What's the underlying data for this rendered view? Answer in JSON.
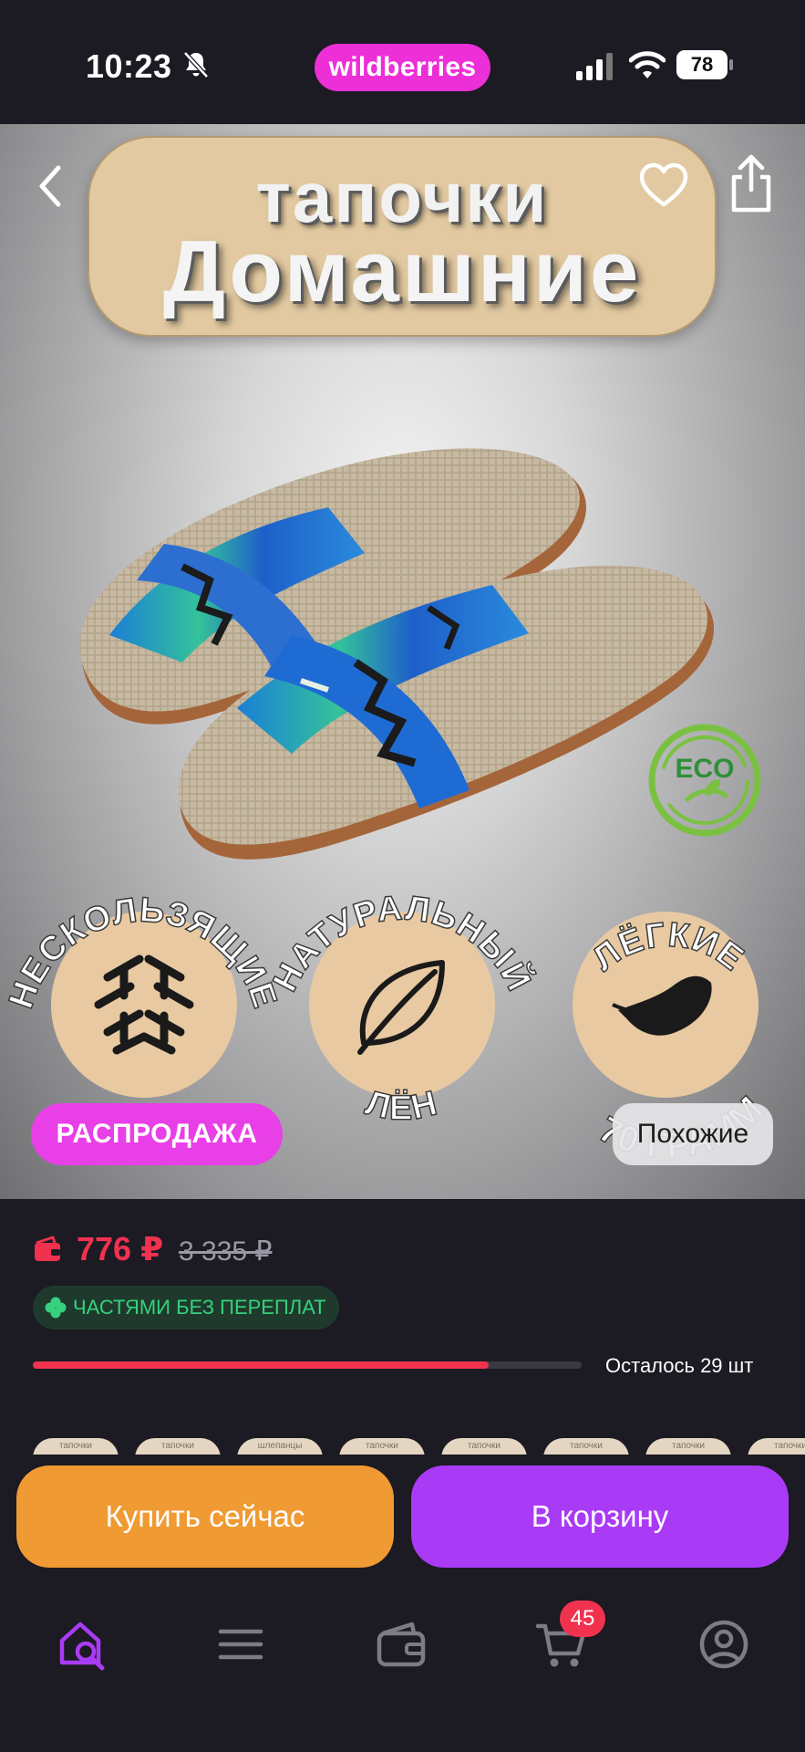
{
  "status_bar": {
    "time": "10:23",
    "brand": "wildberries",
    "battery": "78",
    "icons": [
      "bell-off-icon",
      "signal-icon",
      "wifi-icon",
      "battery-icon"
    ]
  },
  "product_nav": {
    "icons": [
      "back-chevron-icon",
      "heart-icon",
      "share-icon"
    ]
  },
  "product_image": {
    "title_line1": "тапочки",
    "title_line2": "Домашние",
    "eco_badge": "ECO",
    "features": [
      {
        "label": "НЕСКОЛЬЗЯЩИЕ",
        "icon": "weave-pattern-icon"
      },
      {
        "label_top": "НАТУРАЛЬНЫЙ",
        "label_bottom": "ЛЁН",
        "icon": "leaf-icon"
      },
      {
        "label_top": "ЛЁГКИЕ",
        "label_bottom": "70 ГРАММ",
        "icon": "feather-icon"
      }
    ],
    "sale_label": "РАСПРОДАЖА",
    "similar_label": "Похожие"
  },
  "price": {
    "current": "776 ₽",
    "old": "3 335 ₽",
    "installment": "ЧАСТЯМИ БЕЗ ПЕРЕПЛАТ",
    "stock_label": "Осталось 29 шт",
    "stock_fraction": 0.83,
    "accent_color": "#f0324f"
  },
  "thumbnails": [
    "тапочки",
    "тапочки",
    "шлепанцы",
    "тапочки",
    "тапочки",
    "тапочки",
    "тапочки",
    "тапочки"
  ],
  "actions": {
    "buy_now": "Купить сейчас",
    "add_to_cart": "В корзину",
    "buy_color": "#f09a33",
    "cart_color": "#a93bf6"
  },
  "tab_bar": {
    "tabs": [
      "home-search-icon",
      "menu-icon",
      "wallet-icon",
      "cart-icon",
      "profile-icon"
    ],
    "cart_count": "45",
    "active_color": "#a93bf6"
  }
}
